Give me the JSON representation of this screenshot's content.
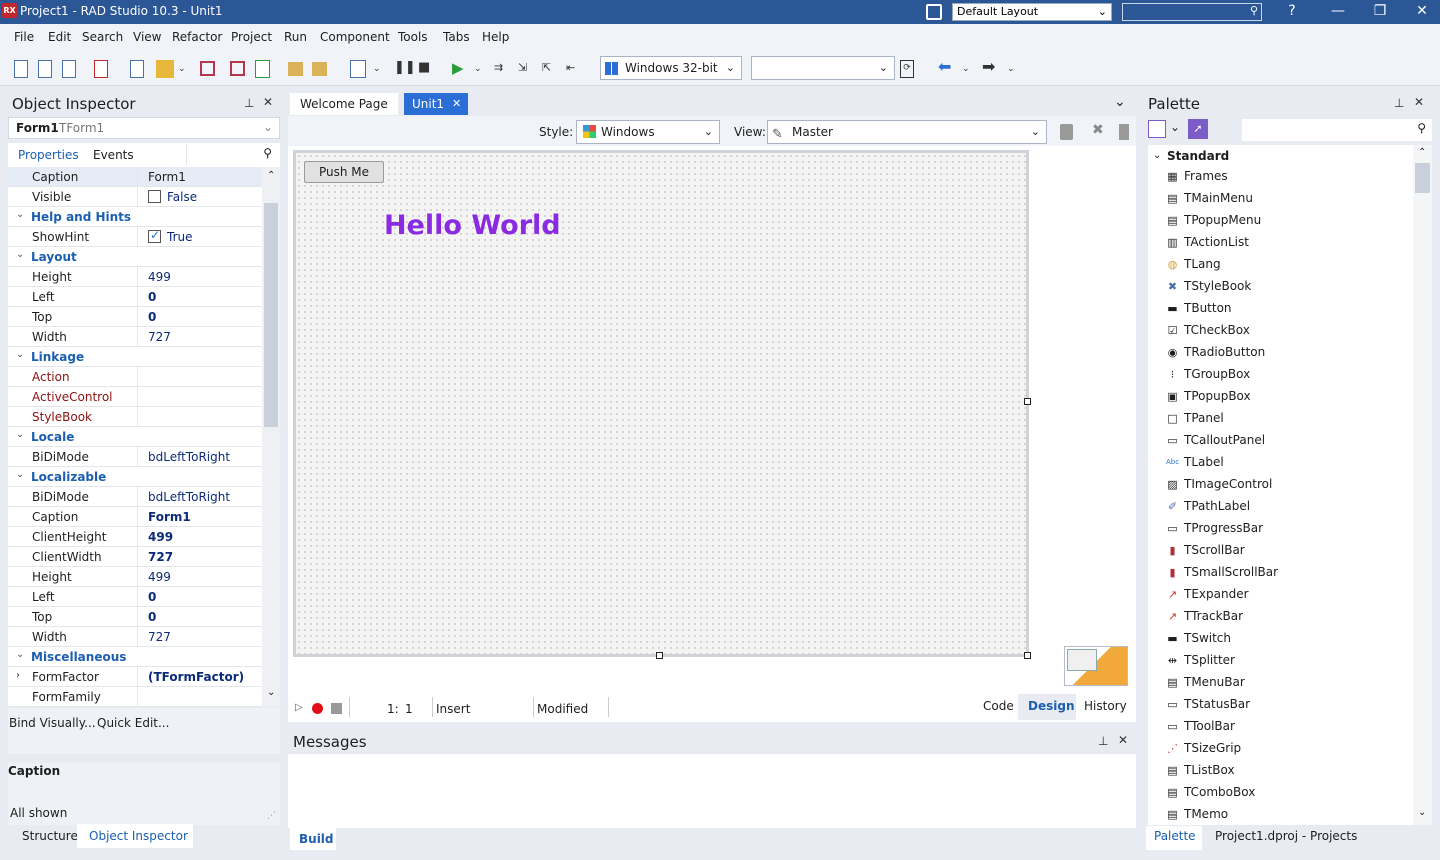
{
  "window": {
    "title": "Project1 - RAD Studio 10.3 - Unit1",
    "logo_text": "RX",
    "layout_select": "Default Layout",
    "help_label": "?",
    "minimize": "—",
    "restore": "❐",
    "close": "✕"
  },
  "menu": [
    "File",
    "Edit",
    "Search",
    "View",
    "Refactor",
    "Project",
    "Run",
    "Component",
    "Tools",
    "Tabs",
    "Help"
  ],
  "toolbar": {
    "platform": "Windows 32-bit",
    "config": ""
  },
  "object_inspector": {
    "title": "Object Inspector",
    "object_name": "Form1",
    "object_type": "TForm1",
    "tabs": [
      "Properties",
      "Events"
    ],
    "rows": [
      {
        "name": "Caption",
        "value": "Form1",
        "kind": "prop"
      },
      {
        "name": "Visible",
        "value": "False",
        "kind": "check",
        "checked": false
      },
      {
        "name": "Help and Hints",
        "kind": "cat"
      },
      {
        "name": "ShowHint",
        "value": "True",
        "kind": "check",
        "checked": true
      },
      {
        "name": "Layout",
        "kind": "cat"
      },
      {
        "name": "Height",
        "value": "499",
        "kind": "prop",
        "style": "navy"
      },
      {
        "name": "Left",
        "value": "0",
        "kind": "prop",
        "style": "navy bold"
      },
      {
        "name": "Top",
        "value": "0",
        "kind": "prop",
        "style": "navy bold"
      },
      {
        "name": "Width",
        "value": "727",
        "kind": "prop",
        "style": "navy"
      },
      {
        "name": "Linkage",
        "kind": "cat"
      },
      {
        "name": "Action",
        "value": "",
        "kind": "prop",
        "name_style": "red"
      },
      {
        "name": "ActiveControl",
        "value": "",
        "kind": "prop",
        "name_style": "red"
      },
      {
        "name": "StyleBook",
        "value": "",
        "kind": "prop",
        "name_style": "red"
      },
      {
        "name": "Locale",
        "kind": "cat"
      },
      {
        "name": "BiDiMode",
        "value": "bdLeftToRight",
        "kind": "prop",
        "style": "navy"
      },
      {
        "name": "Localizable",
        "kind": "cat"
      },
      {
        "name": "BiDiMode",
        "value": "bdLeftToRight",
        "kind": "prop",
        "style": "navy"
      },
      {
        "name": "Caption",
        "value": "Form1",
        "kind": "prop",
        "style": "navy bold"
      },
      {
        "name": "ClientHeight",
        "value": "499",
        "kind": "prop",
        "style": "navy bold"
      },
      {
        "name": "ClientWidth",
        "value": "727",
        "kind": "prop",
        "style": "navy bold"
      },
      {
        "name": "Height",
        "value": "499",
        "kind": "prop",
        "style": "navy"
      },
      {
        "name": "Left",
        "value": "0",
        "kind": "prop",
        "style": "navy bold"
      },
      {
        "name": "Top",
        "value": "0",
        "kind": "prop",
        "style": "navy bold"
      },
      {
        "name": "Width",
        "value": "727",
        "kind": "prop",
        "style": "navy"
      },
      {
        "name": "Miscellaneous",
        "kind": "cat"
      },
      {
        "name": "FormFactor",
        "value": "(TFormFactor)",
        "kind": "prop",
        "style": "navy bold",
        "expand": true
      },
      {
        "name": "FormFamily",
        "value": "",
        "kind": "prop"
      }
    ],
    "bind_visually": "Bind Visually...",
    "quick_edit": "Quick Edit...",
    "desc_title": "Caption",
    "all_shown": "All shown",
    "bottom_tabs": [
      "Structure",
      "Object Inspector"
    ]
  },
  "editor": {
    "tabs": [
      "Welcome Page",
      "Unit1"
    ],
    "style_label": "Style:",
    "style_value": "Windows",
    "view_label": "View:",
    "view_value": "Master",
    "button_caption": "Push Me",
    "label_text": "Hello World",
    "label_color": "#8a2be2",
    "line": "1:",
    "col": "1",
    "insert_mode": "Insert",
    "modified": "Modified",
    "view_tabs": [
      "Code",
      "Design",
      "History"
    ]
  },
  "messages": {
    "title": "Messages",
    "tab": "Build"
  },
  "palette": {
    "title": "Palette",
    "category": "Standard",
    "items": [
      {
        "label": "Frames",
        "icon": "frames-icon"
      },
      {
        "label": "TMainMenu",
        "icon": "mainmenu-icon"
      },
      {
        "label": "TPopupMenu",
        "icon": "popupmenu-icon"
      },
      {
        "label": "TActionList",
        "icon": "actionlist-icon"
      },
      {
        "label": "TLang",
        "icon": "lang-icon"
      },
      {
        "label": "TStyleBook",
        "icon": "stylebook-icon"
      },
      {
        "label": "TButton",
        "icon": "button-icon"
      },
      {
        "label": "TCheckBox",
        "icon": "checkbox-icon"
      },
      {
        "label": "TRadioButton",
        "icon": "radiobutton-icon"
      },
      {
        "label": "TGroupBox",
        "icon": "groupbox-icon"
      },
      {
        "label": "TPopupBox",
        "icon": "popupbox-icon"
      },
      {
        "label": "TPanel",
        "icon": "panel-icon"
      },
      {
        "label": "TCalloutPanel",
        "icon": "calloutpanel-icon"
      },
      {
        "label": "TLabel",
        "icon": "label-icon"
      },
      {
        "label": "TImageControl",
        "icon": "imagecontrol-icon"
      },
      {
        "label": "TPathLabel",
        "icon": "pathlabel-icon"
      },
      {
        "label": "TProgressBar",
        "icon": "progressbar-icon"
      },
      {
        "label": "TScrollBar",
        "icon": "scrollbar-icon"
      },
      {
        "label": "TSmallScrollBar",
        "icon": "smallscrollbar-icon"
      },
      {
        "label": "TExpander",
        "icon": "expander-icon"
      },
      {
        "label": "TTrackBar",
        "icon": "trackbar-icon"
      },
      {
        "label": "TSwitch",
        "icon": "switch-icon"
      },
      {
        "label": "TSplitter",
        "icon": "splitter-icon"
      },
      {
        "label": "TMenuBar",
        "icon": "menubar-icon"
      },
      {
        "label": "TStatusBar",
        "icon": "statusbar-icon"
      },
      {
        "label": "TToolBar",
        "icon": "toolbar-icon"
      },
      {
        "label": "TSizeGrip",
        "icon": "sizegrip-icon"
      },
      {
        "label": "TListBox",
        "icon": "listbox-icon"
      },
      {
        "label": "TComboBox",
        "icon": "combobox-icon"
      },
      {
        "label": "TMemo",
        "icon": "memo-icon"
      }
    ],
    "bottom_tabs": [
      "Palette",
      "Project1.dproj - Projects"
    ]
  },
  "colors": {
    "titlebar": "#2b5797",
    "accent": "#1c5fb0",
    "active_tab": "#2b6fd6"
  }
}
